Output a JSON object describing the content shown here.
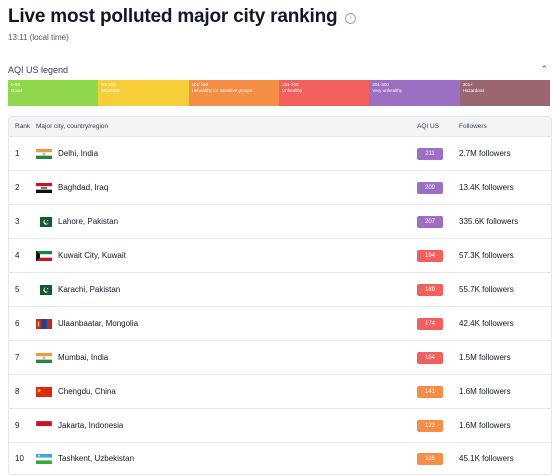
{
  "page": {
    "title": "Live most polluted major city ranking",
    "time": "13:11 (local time)"
  },
  "legend": {
    "title": "AQI US legend",
    "segments": [
      {
        "range": "0-50",
        "label": "Good",
        "color": "#8fd84a"
      },
      {
        "range": "51-100",
        "label": "Moderate",
        "color": "#f7ce3a"
      },
      {
        "range": "101-150",
        "label": "Unhealthy for sensitive groups",
        "color": "#f48d45"
      },
      {
        "range": "151-200",
        "label": "Unhealthy",
        "color": "#f25f5c"
      },
      {
        "range": "201-300",
        "label": "Very unhealthy",
        "color": "#9c6fc3"
      },
      {
        "range": "301+",
        "label": "Hazardous",
        "color": "#9b6670"
      }
    ]
  },
  "table": {
    "headers": {
      "rank": "Rank",
      "city": "Major city, country/region",
      "aqi": "AQI US",
      "followers": "Followers"
    },
    "rows": [
      {
        "rank": "1",
        "city": "Delhi, India",
        "aqi": "211",
        "followers": "2.7M followers",
        "flag": "india",
        "color": "#9c6fc3"
      },
      {
        "rank": "2",
        "city": "Baghdad, Iraq",
        "aqi": "209",
        "followers": "13.4K followers",
        "flag": "iraq",
        "color": "#9c6fc3"
      },
      {
        "rank": "3",
        "city": "Lahore, Pakistan",
        "aqi": "207",
        "followers": "335.6K followers",
        "flag": "pakistan",
        "color": "#9c6fc3"
      },
      {
        "rank": "4",
        "city": "Kuwait City, Kuwait",
        "aqi": "194",
        "followers": "57.3K followers",
        "flag": "kuwait",
        "color": "#f25f5c"
      },
      {
        "rank": "5",
        "city": "Karachi, Pakistan",
        "aqi": "189",
        "followers": "55.7K followers",
        "flag": "pakistan",
        "color": "#f25f5c"
      },
      {
        "rank": "6",
        "city": "Ulaanbaatar, Mongolia",
        "aqi": "174",
        "followers": "42.4K followers",
        "flag": "mongolia",
        "color": "#f25f5c"
      },
      {
        "rank": "7",
        "city": "Mumbai, India",
        "aqi": "164",
        "followers": "1.5M followers",
        "flag": "india",
        "color": "#f25f5c"
      },
      {
        "rank": "8",
        "city": "Chengdu, China",
        "aqi": "141",
        "followers": "1.6M followers",
        "flag": "china",
        "color": "#f48d45"
      },
      {
        "rank": "9",
        "city": "Jakarta, Indonesia",
        "aqi": "122",
        "followers": "1.6M followers",
        "flag": "indonesia",
        "color": "#f48d45"
      },
      {
        "rank": "10",
        "city": "Tashkent, Uzbekistan",
        "aqi": "116",
        "followers": "45.1K followers",
        "flag": "uzbekistan",
        "color": "#f48d45"
      }
    ]
  }
}
